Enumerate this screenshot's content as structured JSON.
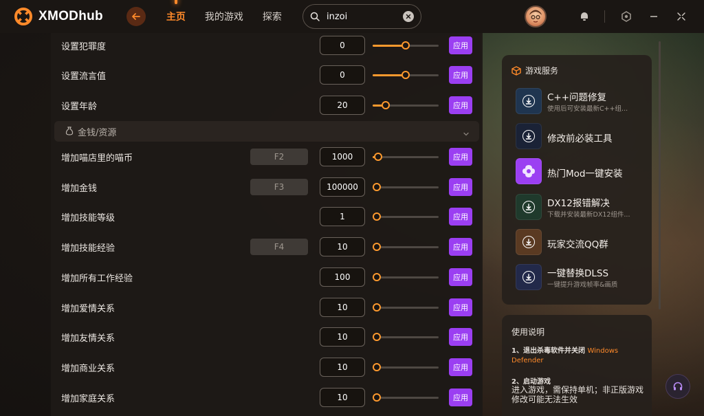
{
  "app": {
    "name": "XMODhub"
  },
  "nav": {
    "items": [
      "主页",
      "我的游戏",
      "探索"
    ]
  },
  "search": {
    "value": "inzoi"
  },
  "settings": {
    "rows_top": [
      {
        "label": "设置犯罪度",
        "value": "0",
        "slider": 0.5,
        "apply": "应用"
      },
      {
        "label": "设置流言值",
        "value": "0",
        "slider": 0.5,
        "apply": "应用"
      },
      {
        "label": "设置年龄",
        "value": "20",
        "slider": 0.2,
        "apply": "应用"
      }
    ],
    "section": {
      "title": "金钱/资源"
    },
    "rows": [
      {
        "label": "增加喵店里的喵币",
        "hotkey": "F2",
        "value": "1000",
        "slider": 0.08,
        "apply": "应用"
      },
      {
        "label": "增加金钱",
        "hotkey": "F3",
        "value": "100000",
        "slider": 0,
        "apply": "应用"
      },
      {
        "label": "增加技能等级",
        "hotkey": "",
        "value": "1",
        "slider": 0,
        "apply": "应用"
      },
      {
        "label": "增加技能经验",
        "hotkey": "F4",
        "value": "10",
        "slider": 0,
        "apply": "应用"
      },
      {
        "label": "增加所有工作经验",
        "hotkey": "",
        "value": "100",
        "slider": 0,
        "apply": "应用"
      },
      {
        "label": "增加爱情关系",
        "hotkey": "",
        "value": "10",
        "slider": 0,
        "apply": "应用"
      },
      {
        "label": "增加友情关系",
        "hotkey": "",
        "value": "10",
        "slider": 0,
        "apply": "应用"
      },
      {
        "label": "增加商业关系",
        "hotkey": "",
        "value": "10",
        "slider": 0,
        "apply": "应用"
      },
      {
        "label": "增加家庭关系",
        "hotkey": "",
        "value": "10",
        "slider": 0,
        "apply": "应用"
      }
    ]
  },
  "services": {
    "title": "游戏服务",
    "items": [
      {
        "title": "C++问题修复",
        "subtitle": "使用后可安装最新C++组...",
        "color": "#1f3550"
      },
      {
        "title": "修改前必装工具",
        "subtitle": "",
        "color": "#1a2236"
      },
      {
        "title": "热门Mod一键安装",
        "subtitle": "",
        "color": "#9b3ff2"
      },
      {
        "title": "DX12报错解决",
        "subtitle": "下载并安装最新DX12组件...",
        "color": "#1f3a2c"
      },
      {
        "title": "玩家交流QQ群",
        "subtitle": "",
        "color": "#5a3a22"
      },
      {
        "title": "一键替换DLSS",
        "subtitle": "一键提升游戏帧率&画质",
        "color": "#22294a"
      }
    ]
  },
  "guide": {
    "title": "使用说明",
    "step1_prefix": "1、退出杀毒软件并关闭",
    "step1_accent": "Windows Defender",
    "step2": "2、启动游戏",
    "step2_text": "进入游戏，需保持单机；非正版游戏修改可能无法生效"
  },
  "colors": {
    "accent": "#ff8a2a",
    "apply": "#9b3ff2"
  }
}
